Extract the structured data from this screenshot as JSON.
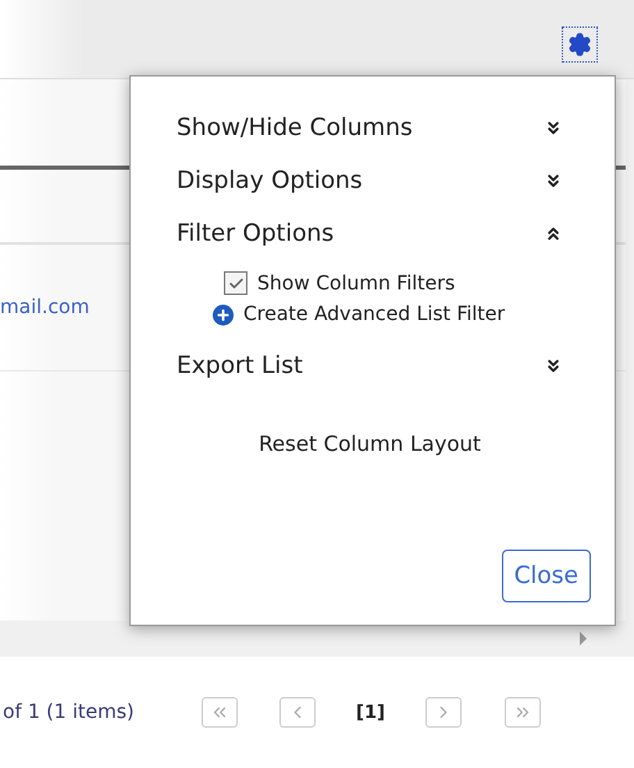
{
  "table": {
    "cell_text": "mail.com"
  },
  "settings_menu": {
    "sections": [
      {
        "label": "Show/Hide Columns",
        "expanded": false
      },
      {
        "label": "Display Options",
        "expanded": false
      },
      {
        "label": "Filter Options",
        "expanded": true,
        "children": [
          {
            "kind": "checkbox",
            "label": "Show Column Filters",
            "checked": true
          },
          {
            "kind": "link",
            "label": "Create Advanced List Filter"
          }
        ]
      },
      {
        "label": "Export List",
        "expanded": false
      }
    ],
    "reset_link": "Reset Column Layout",
    "close_button": "Close"
  },
  "pager": {
    "summary": "of 1 (1 items)",
    "current_page": "[1]"
  }
}
